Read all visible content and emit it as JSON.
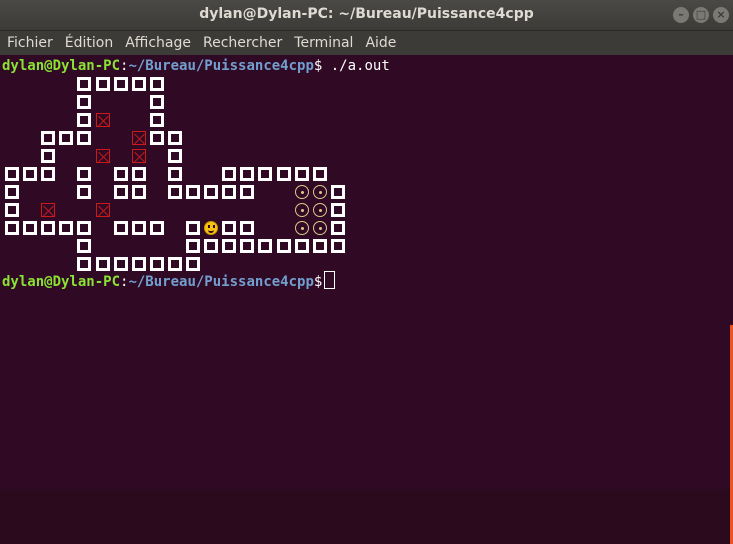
{
  "window": {
    "title": "dylan@Dylan-PC: ~/Bureau/Puissance4cpp",
    "buttons": [
      "–",
      "□",
      "×"
    ]
  },
  "menu": [
    "Fichier",
    "Édition",
    "Affichage",
    "Rechercher",
    "Terminal",
    "Aide"
  ],
  "prompt": {
    "user_host": "dylan@Dylan-PC",
    "separator": ":",
    "path": "~/Bureau/Puissance4cpp",
    "symbol": "$",
    "command": " ./a.out"
  },
  "board": [
    "    WWWWW          ",
    "    W   W          ",
    "    WT  W          ",
    "  WWW  TWW         ",
    "  W  T T W         ",
    "WWW W WW W  WWWWWW ",
    "W   W WW WWWWW  CCW",
    "W T  T          CCW",
    "WWWWW WWW WSWW  CCW",
    "    W     WWWWWWWWW",
    "    WWWWWWW        "
  ],
  "colors": {
    "wall": "#ffffff",
    "trap": "#cc1a1a",
    "coin": "#d8c98a",
    "player": "#f5c211",
    "background": "#300a24"
  }
}
